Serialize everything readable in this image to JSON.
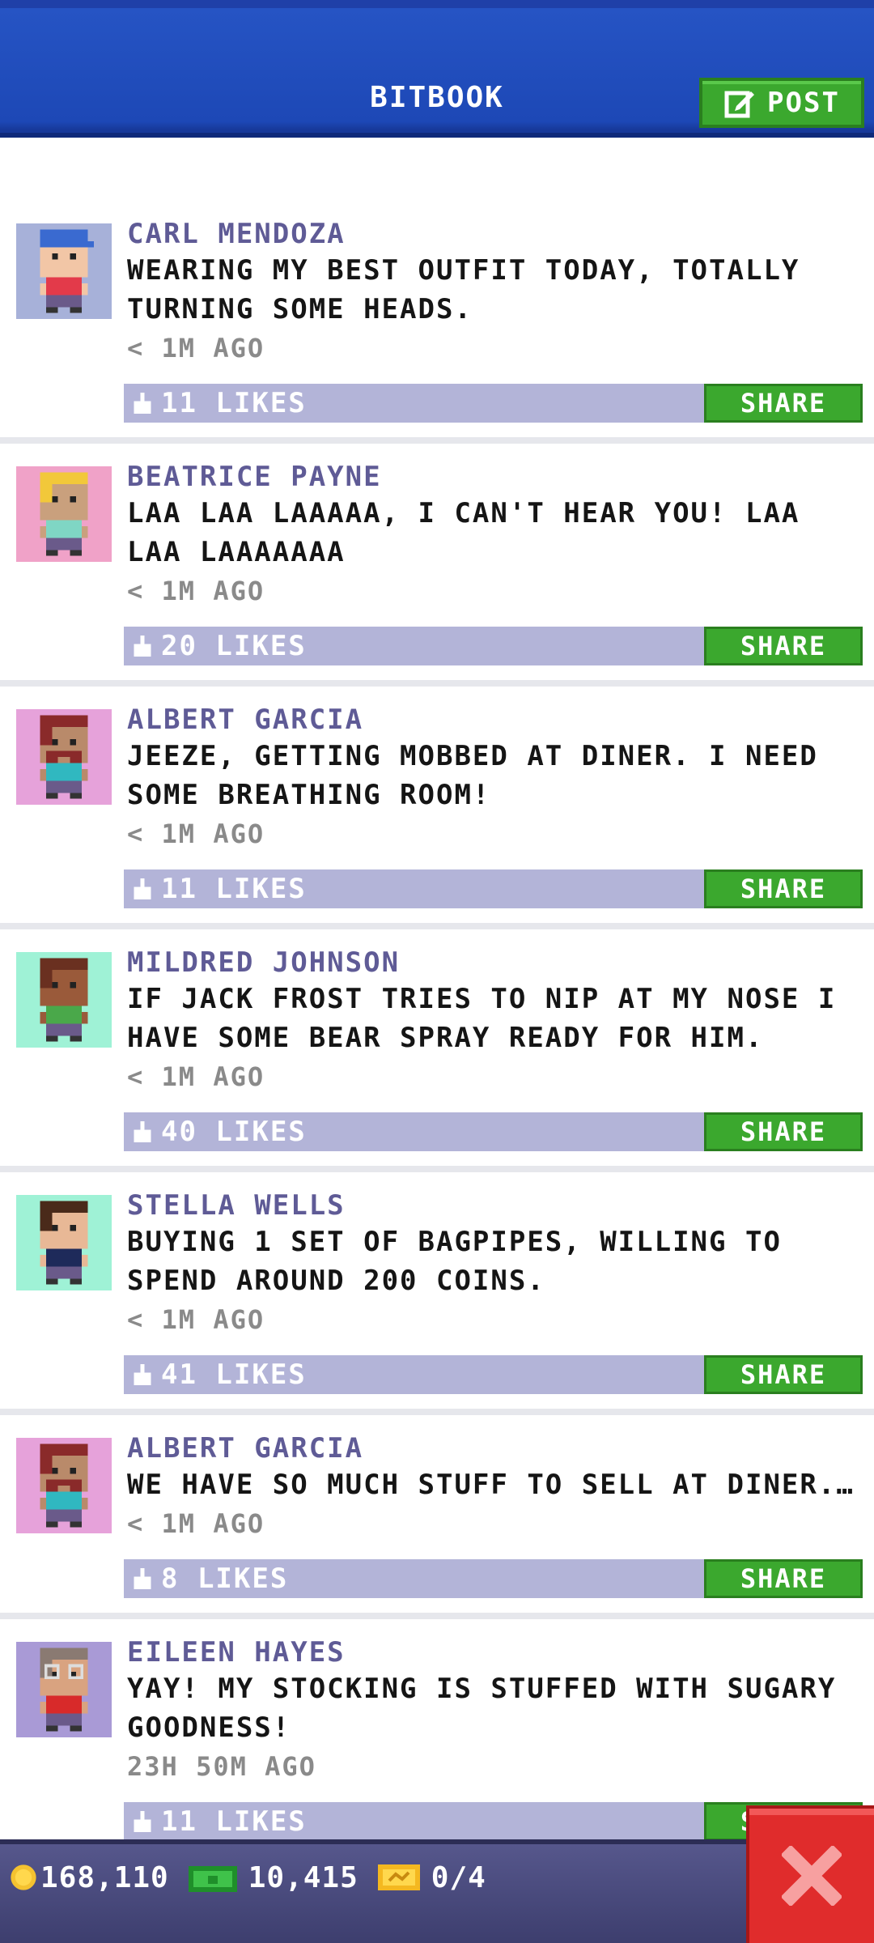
{
  "header": {
    "title": "BITBOOK",
    "post_label": "POST"
  },
  "feed": {
    "posts": [
      {
        "author": "CARL MENDOZA",
        "message": "WEARING MY BEST OUTFIT TODAY, TOTALLY TURNING SOME HEADS.",
        "time": "< 1M AGO",
        "likes": "11 LIKES",
        "share_label": "SHARE",
        "avatar_bg": "#a7b1d9",
        "skin": "#f2c6a6",
        "hair": "#3a6ad0",
        "shirt": "#e33a4a",
        "beard": false,
        "cap": true
      },
      {
        "author": "BEATRICE PAYNE",
        "message": "LAA LAA LAAAAA, I CAN'T HEAR YOU! LAA LAA LAAAAAAA",
        "time": "< 1M AGO",
        "likes": "20 LIKES",
        "share_label": "SHARE",
        "avatar_bg": "#f0a2c8",
        "skin": "#c9a07d",
        "hair": "#f2c83a",
        "shirt": "#7fd6c4",
        "beard": false,
        "cap": false
      },
      {
        "author": "ALBERT GARCIA",
        "message": "JEEZE, GETTING MOBBED AT DINER. I NEED SOME BREATHING ROOM!",
        "time": "< 1M AGO",
        "likes": "11 LIKES",
        "share_label": "SHARE",
        "avatar_bg": "#e6a2da",
        "skin": "#b98a6a",
        "hair": "#8a2a2a",
        "shirt": "#30b8c0",
        "beard": true,
        "cap": false
      },
      {
        "author": "MILDRED JOHNSON",
        "message": "IF JACK FROST TRIES TO NIP AT MY NOSE I HAVE SOME BEAR SPRAY READY FOR HIM.",
        "time": "< 1M AGO",
        "likes": "40 LIKES",
        "share_label": "SHARE",
        "avatar_bg": "#9ff2d6",
        "skin": "#9a5a3a",
        "hair": "#6a3020",
        "shirt": "#4aa84a",
        "beard": false,
        "cap": false
      },
      {
        "author": "STELLA WELLS",
        "message": "BUYING 1 SET OF BAGPIPES, WILLING TO SPEND AROUND 200 COINS.",
        "time": "< 1M AGO",
        "likes": "41 LIKES",
        "share_label": "SHARE",
        "avatar_bg": "#9ff2d6",
        "skin": "#e8b896",
        "hair": "#4a2a1a",
        "shirt": "#1e2a5a",
        "beard": false,
        "cap": false
      },
      {
        "author": "ALBERT GARCIA",
        "message": "WE HAVE SO MUCH STUFF TO SELL AT DINER...",
        "time": "< 1M AGO",
        "likes": "8 LIKES",
        "share_label": "SHARE",
        "avatar_bg": "#e6a2da",
        "skin": "#b98a6a",
        "hair": "#8a2a2a",
        "shirt": "#30b8c0",
        "beard": true,
        "cap": false
      },
      {
        "author": "EILEEN HAYES",
        "message": "YAY! MY STOCKING IS STUFFED WITH SUGARY GOODNESS!",
        "time": "23H 50M AGO",
        "likes": "11 LIKES",
        "share_label": "SHARE",
        "avatar_bg": "#a99ad6",
        "skin": "#d9a380",
        "hair": "#8a7a72",
        "shirt": "#d82a2a",
        "beard": false,
        "cap": false,
        "glasses": true
      }
    ]
  },
  "bottom": {
    "coins": "168,110",
    "bux": "10,415",
    "tickets": "0/4"
  },
  "colors": {
    "header_blue": "#1d48b6",
    "accent_green": "#3ba82e",
    "like_bar": "#b3b4d8",
    "author_purple": "#5f5b96",
    "close_red": "#e02c2c"
  }
}
